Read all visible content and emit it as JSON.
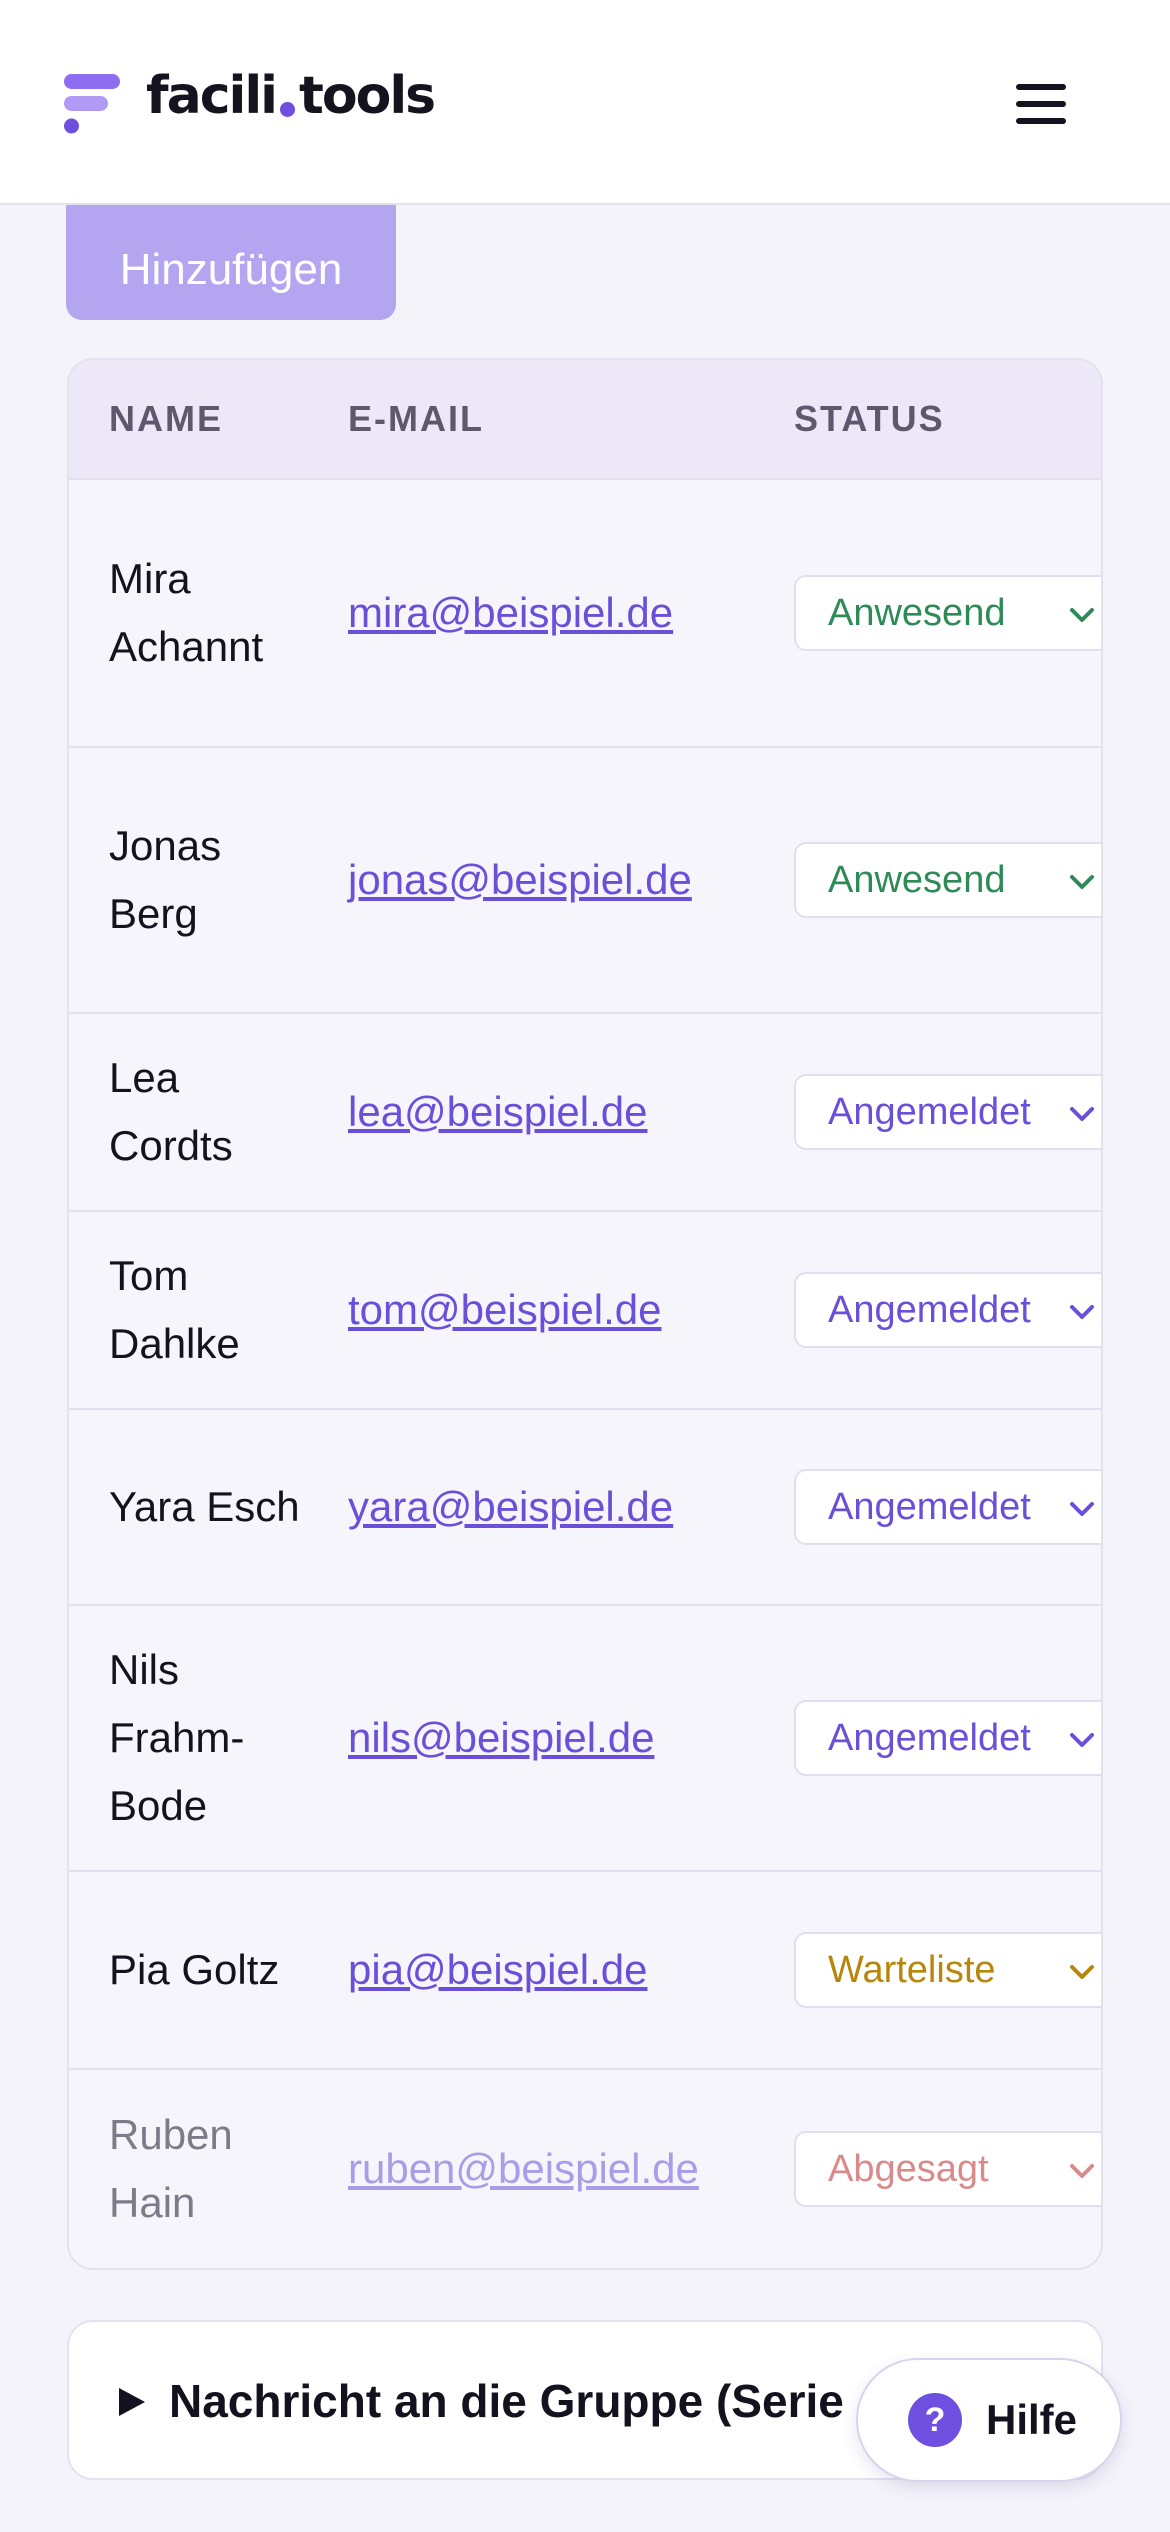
{
  "header": {
    "logo_left": "facili",
    "logo_right": "tools",
    "menu_icon": "hamburger-menu-icon",
    "brand_color": "#6e4fe0"
  },
  "actions": {
    "add_label": "Hinzufügen"
  },
  "table": {
    "headers": {
      "name": "NAME",
      "email": "E-MAIL",
      "status": "STATUS"
    },
    "rows": [
      {
        "name": "Mira Achannt",
        "email": "mira@beispiel.de",
        "status": "Anwesend",
        "status_color": "#2e8b57"
      },
      {
        "name": "Jonas Berg",
        "email": "jonas@beispiel.de",
        "status": "Anwesend",
        "status_color": "#2e8b57"
      },
      {
        "name": "Lea Cordts",
        "email": "lea@beispiel.de",
        "status": "Angemeldet",
        "status_color": "#6a4fd9"
      },
      {
        "name": "Tom Dahlke",
        "email": "tom@beispiel.de",
        "status": "Angemeldet",
        "status_color": "#6a4fd9"
      },
      {
        "name": "Yara Esch",
        "email": "yara@beispiel.de",
        "status": "Angemeldet",
        "status_color": "#6a4fd9"
      },
      {
        "name": "Nils Frahm-Bode",
        "email": "nils@beispiel.de",
        "status": "Angemeldet",
        "status_color": "#6a4fd9"
      },
      {
        "name": "Pia Goltz",
        "email": "pia@beispiel.de",
        "status": "Warteliste",
        "status_color": "#b8860b"
      },
      {
        "name": "Ruben Hain",
        "email": "ruben@beispiel.de",
        "status": "Abgesagt",
        "status_color": "#d98b8b"
      }
    ]
  },
  "message_panel": {
    "title": "Nachricht an die Gruppe (Serie"
  },
  "help": {
    "label": "Hilfe",
    "icon_glyph": "?"
  }
}
